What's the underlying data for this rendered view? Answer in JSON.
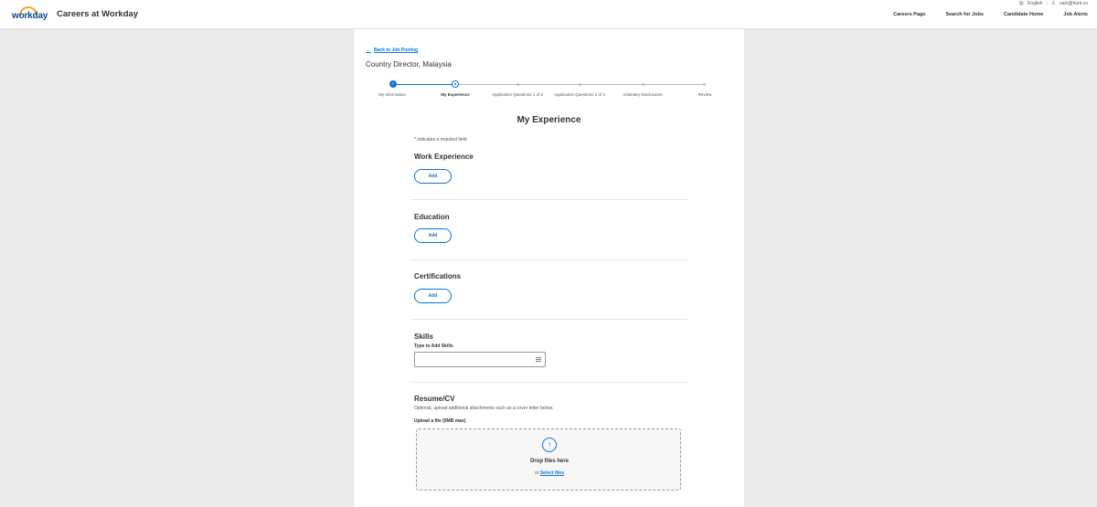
{
  "header": {
    "logo_text": "workday",
    "site_title": "Careers at Workday",
    "language": "English",
    "user_email": "sam@hunt.co",
    "nav": [
      "Careers Page",
      "Search for Jobs",
      "Candidate Home",
      "Job Alerts"
    ]
  },
  "page": {
    "back_link": "Back to Job Posting",
    "job_title": "Country Director, Malaysia",
    "heading": "My Experience",
    "required_note": "indicates a required field"
  },
  "progress": {
    "steps": [
      {
        "label": "My Information",
        "state": "done"
      },
      {
        "label": "My Experience",
        "state": "current"
      },
      {
        "label": "Application Questions 1 of 2",
        "state": "todo"
      },
      {
        "label": "Application Questions 2 of 2",
        "state": "todo"
      },
      {
        "label": "Voluntary Disclosures",
        "state": "todo"
      },
      {
        "label": "Review",
        "state": "todo"
      }
    ]
  },
  "sections": {
    "work_experience": {
      "title": "Work Experience",
      "button": "Add"
    },
    "education": {
      "title": "Education",
      "button": "Add"
    },
    "certifications": {
      "title": "Certifications",
      "button": "Add"
    },
    "skills": {
      "title": "Skills",
      "label": "Type to Add Skills",
      "value": ""
    },
    "resume": {
      "title": "Resume/CV",
      "description": "Optional, upload additional attachments such as a cover letter below.",
      "upload_label": "Upload a file (5MB max)",
      "drop_text": "Drop files here",
      "or_text": "or",
      "select_files": "Select files"
    }
  },
  "colors": {
    "accent": "#0875e1",
    "required": "#d0021b",
    "logo_arc": "#f5a623"
  }
}
